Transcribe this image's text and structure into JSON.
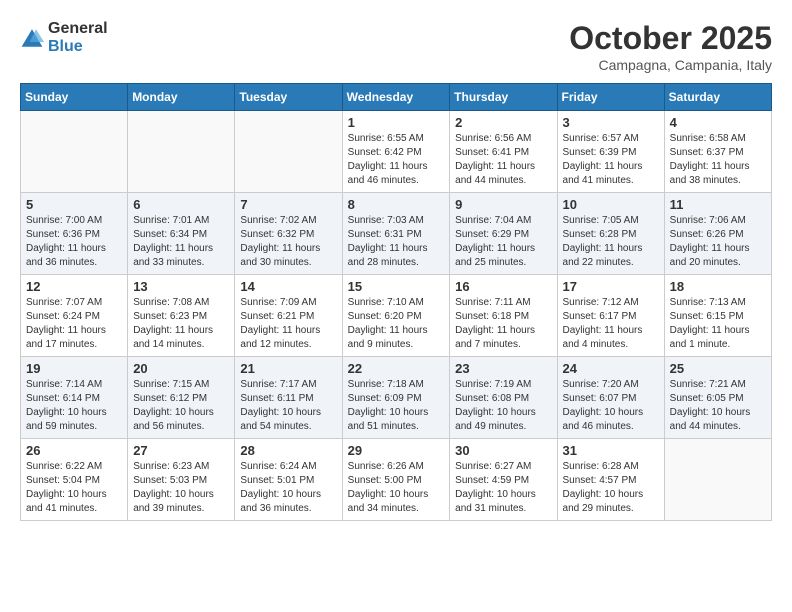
{
  "logo": {
    "general": "General",
    "blue": "Blue"
  },
  "header": {
    "month": "October 2025",
    "location": "Campagna, Campania, Italy"
  },
  "weekdays": [
    "Sunday",
    "Monday",
    "Tuesday",
    "Wednesday",
    "Thursday",
    "Friday",
    "Saturday"
  ],
  "weeks": [
    [
      {
        "day": "",
        "info": ""
      },
      {
        "day": "",
        "info": ""
      },
      {
        "day": "",
        "info": ""
      },
      {
        "day": "1",
        "info": "Sunrise: 6:55 AM\nSunset: 6:42 PM\nDaylight: 11 hours and 46 minutes."
      },
      {
        "day": "2",
        "info": "Sunrise: 6:56 AM\nSunset: 6:41 PM\nDaylight: 11 hours and 44 minutes."
      },
      {
        "day": "3",
        "info": "Sunrise: 6:57 AM\nSunset: 6:39 PM\nDaylight: 11 hours and 41 minutes."
      },
      {
        "day": "4",
        "info": "Sunrise: 6:58 AM\nSunset: 6:37 PM\nDaylight: 11 hours and 38 minutes."
      }
    ],
    [
      {
        "day": "5",
        "info": "Sunrise: 7:00 AM\nSunset: 6:36 PM\nDaylight: 11 hours and 36 minutes."
      },
      {
        "day": "6",
        "info": "Sunrise: 7:01 AM\nSunset: 6:34 PM\nDaylight: 11 hours and 33 minutes."
      },
      {
        "day": "7",
        "info": "Sunrise: 7:02 AM\nSunset: 6:32 PM\nDaylight: 11 hours and 30 minutes."
      },
      {
        "day": "8",
        "info": "Sunrise: 7:03 AM\nSunset: 6:31 PM\nDaylight: 11 hours and 28 minutes."
      },
      {
        "day": "9",
        "info": "Sunrise: 7:04 AM\nSunset: 6:29 PM\nDaylight: 11 hours and 25 minutes."
      },
      {
        "day": "10",
        "info": "Sunrise: 7:05 AM\nSunset: 6:28 PM\nDaylight: 11 hours and 22 minutes."
      },
      {
        "day": "11",
        "info": "Sunrise: 7:06 AM\nSunset: 6:26 PM\nDaylight: 11 hours and 20 minutes."
      }
    ],
    [
      {
        "day": "12",
        "info": "Sunrise: 7:07 AM\nSunset: 6:24 PM\nDaylight: 11 hours and 17 minutes."
      },
      {
        "day": "13",
        "info": "Sunrise: 7:08 AM\nSunset: 6:23 PM\nDaylight: 11 hours and 14 minutes."
      },
      {
        "day": "14",
        "info": "Sunrise: 7:09 AM\nSunset: 6:21 PM\nDaylight: 11 hours and 12 minutes."
      },
      {
        "day": "15",
        "info": "Sunrise: 7:10 AM\nSunset: 6:20 PM\nDaylight: 11 hours and 9 minutes."
      },
      {
        "day": "16",
        "info": "Sunrise: 7:11 AM\nSunset: 6:18 PM\nDaylight: 11 hours and 7 minutes."
      },
      {
        "day": "17",
        "info": "Sunrise: 7:12 AM\nSunset: 6:17 PM\nDaylight: 11 hours and 4 minutes."
      },
      {
        "day": "18",
        "info": "Sunrise: 7:13 AM\nSunset: 6:15 PM\nDaylight: 11 hours and 1 minute."
      }
    ],
    [
      {
        "day": "19",
        "info": "Sunrise: 7:14 AM\nSunset: 6:14 PM\nDaylight: 10 hours and 59 minutes."
      },
      {
        "day": "20",
        "info": "Sunrise: 7:15 AM\nSunset: 6:12 PM\nDaylight: 10 hours and 56 minutes."
      },
      {
        "day": "21",
        "info": "Sunrise: 7:17 AM\nSunset: 6:11 PM\nDaylight: 10 hours and 54 minutes."
      },
      {
        "day": "22",
        "info": "Sunrise: 7:18 AM\nSunset: 6:09 PM\nDaylight: 10 hours and 51 minutes."
      },
      {
        "day": "23",
        "info": "Sunrise: 7:19 AM\nSunset: 6:08 PM\nDaylight: 10 hours and 49 minutes."
      },
      {
        "day": "24",
        "info": "Sunrise: 7:20 AM\nSunset: 6:07 PM\nDaylight: 10 hours and 46 minutes."
      },
      {
        "day": "25",
        "info": "Sunrise: 7:21 AM\nSunset: 6:05 PM\nDaylight: 10 hours and 44 minutes."
      }
    ],
    [
      {
        "day": "26",
        "info": "Sunrise: 6:22 AM\nSunset: 5:04 PM\nDaylight: 10 hours and 41 minutes."
      },
      {
        "day": "27",
        "info": "Sunrise: 6:23 AM\nSunset: 5:03 PM\nDaylight: 10 hours and 39 minutes."
      },
      {
        "day": "28",
        "info": "Sunrise: 6:24 AM\nSunset: 5:01 PM\nDaylight: 10 hours and 36 minutes."
      },
      {
        "day": "29",
        "info": "Sunrise: 6:26 AM\nSunset: 5:00 PM\nDaylight: 10 hours and 34 minutes."
      },
      {
        "day": "30",
        "info": "Sunrise: 6:27 AM\nSunset: 4:59 PM\nDaylight: 10 hours and 31 minutes."
      },
      {
        "day": "31",
        "info": "Sunrise: 6:28 AM\nSunset: 4:57 PM\nDaylight: 10 hours and 29 minutes."
      },
      {
        "day": "",
        "info": ""
      }
    ]
  ]
}
